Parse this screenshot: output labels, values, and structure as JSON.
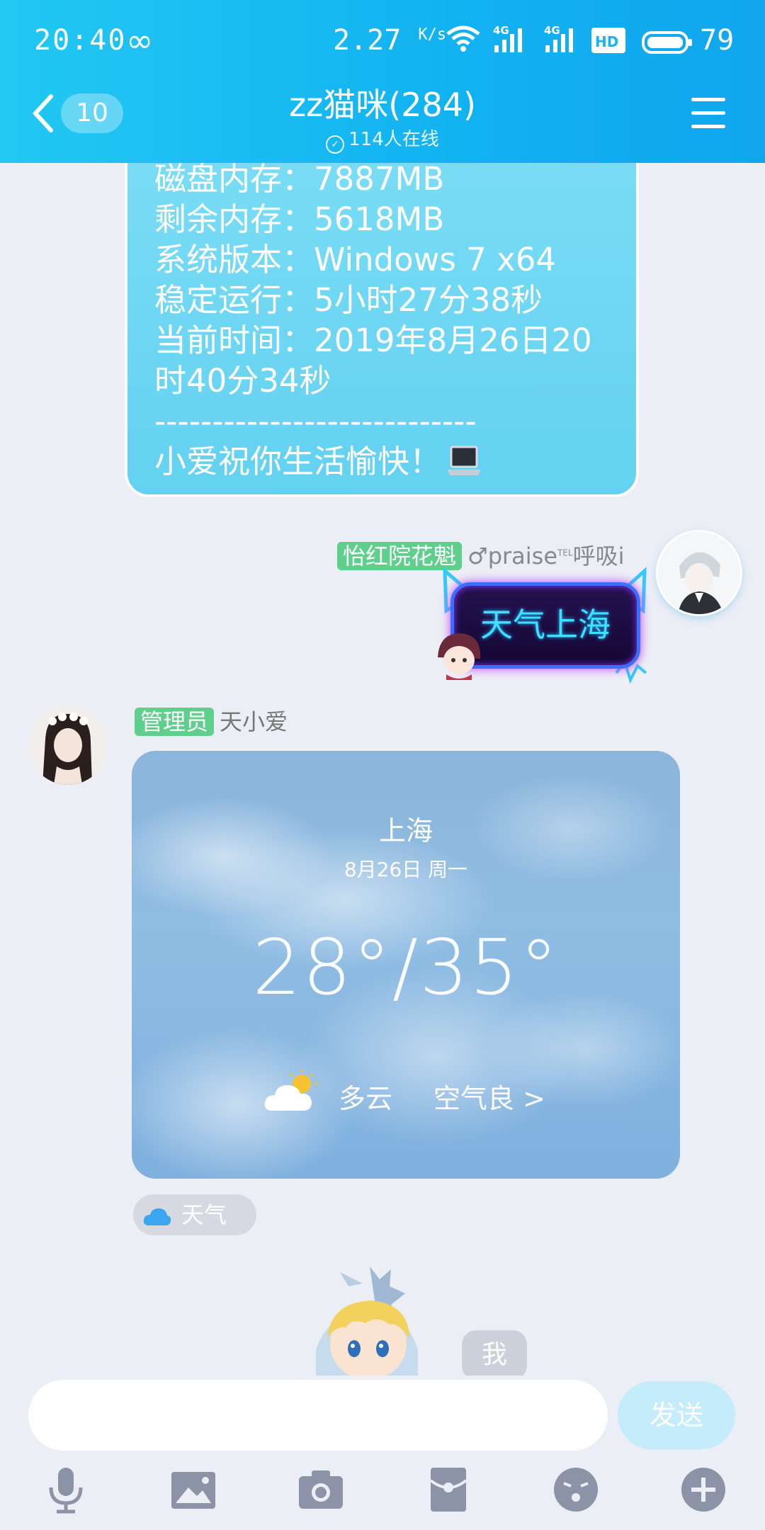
{
  "status_bar": {
    "time": "20:40",
    "net_speed": "2.27",
    "net_speed_unit": "K/s",
    "signal_1_label": "4G",
    "signal_2_label": "4G",
    "battery": "79"
  },
  "header": {
    "back_count": "10",
    "title": "zz猫咪(284)",
    "online": "114人在线"
  },
  "sysinfo_message": {
    "lines": [
      "磁盘内存：7887MB",
      "剩余内存：5618MB",
      "系统版本：Windows 7 x64",
      "稳定运行：5小时27分38秒",
      "当前时间：2019年8月26日20时40分34秒",
      "----------------------------",
      "小爱祝你生活愉快！"
    ]
  },
  "sent_message": {
    "badge": "怡红院花魁",
    "sender": "♂praise",
    "sender_sup": "TEL",
    "sender_suffix": "呼吸i",
    "text": "天气上海",
    "badge_color": "#5fcf8c"
  },
  "bot_message": {
    "badge": "管理员",
    "sender": "天小爱",
    "badge_color": "#5fcf8c",
    "weather": {
      "city": "上海",
      "date": "8月26日 周一",
      "temperature": "28°/35°",
      "condition": "多云",
      "air_quality": "空气良 >"
    },
    "chip_label": "天气"
  },
  "partial_message": {
    "text": "我"
  },
  "input": {
    "placeholder": "",
    "send_label": "发送"
  },
  "colors": {
    "accent": "#12b2f1",
    "send_disabled": "#c5ecfb"
  },
  "toolbar_icons": [
    "mic-icon",
    "image-icon",
    "camera-icon",
    "red-packet-icon",
    "emoji-icon",
    "plus-icon"
  ]
}
